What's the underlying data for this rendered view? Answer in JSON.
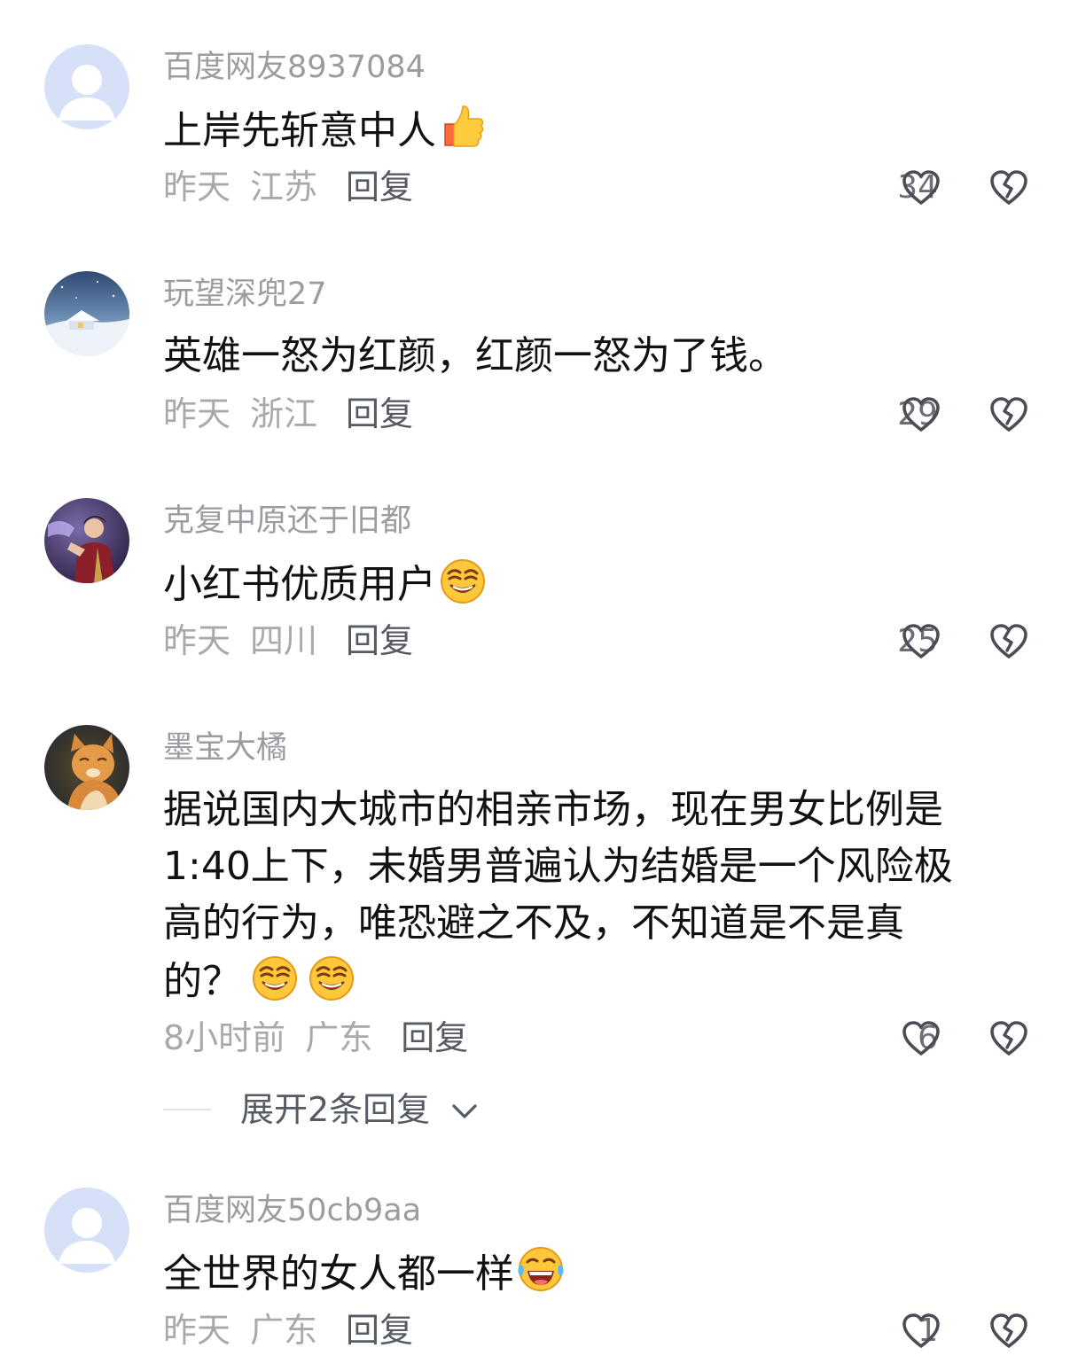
{
  "comments": [
    {
      "username": "百度网友8937084",
      "text": "上岸先斩意中人",
      "emoji": "thumbs-up",
      "time": "昨天",
      "location": "江苏",
      "reply": "回复",
      "likes": "34"
    },
    {
      "username": "玩望深兜27",
      "text": "英雄一怒为红颜，红颜一怒为了钱。",
      "time": "昨天",
      "location": "浙江",
      "reply": "回复",
      "likes": "29"
    },
    {
      "username": "克复中原还于旧都",
      "text": "小红书优质用户",
      "emoji": "smirk-face",
      "time": "昨天",
      "location": "四川",
      "reply": "回复",
      "likes": "25"
    },
    {
      "username": "墨宝大橘",
      "text_lines": [
        "据说国内大城市的相亲市场，现在男女比例是",
        "1:40上下，未婚男普遍认为结婚是一个风险极",
        "高的行为，唯恐避之不及，不知道是不是真",
        "的？"
      ],
      "emoji": "smirk-face",
      "time": "8小时前",
      "location": "广东",
      "reply": "回复",
      "likes": "6",
      "expand_replies": "展开2条回复"
    },
    {
      "username": "百度网友50cb9aa",
      "text": "全世界的女人都一样",
      "emoji": "laughing-tears-face",
      "time": "昨天",
      "location": "广东",
      "reply": "回复",
      "likes": "1"
    }
  ],
  "icons": {
    "like": "heart-outline-icon",
    "dislike": "broken-heart-icon",
    "expand": "chevron-down-icon"
  },
  "colors": {
    "username": "#9b9ca1",
    "text": "#111111",
    "meta": "#a8a9ae",
    "reply": "#555a63",
    "icon": "#4a4d55"
  }
}
